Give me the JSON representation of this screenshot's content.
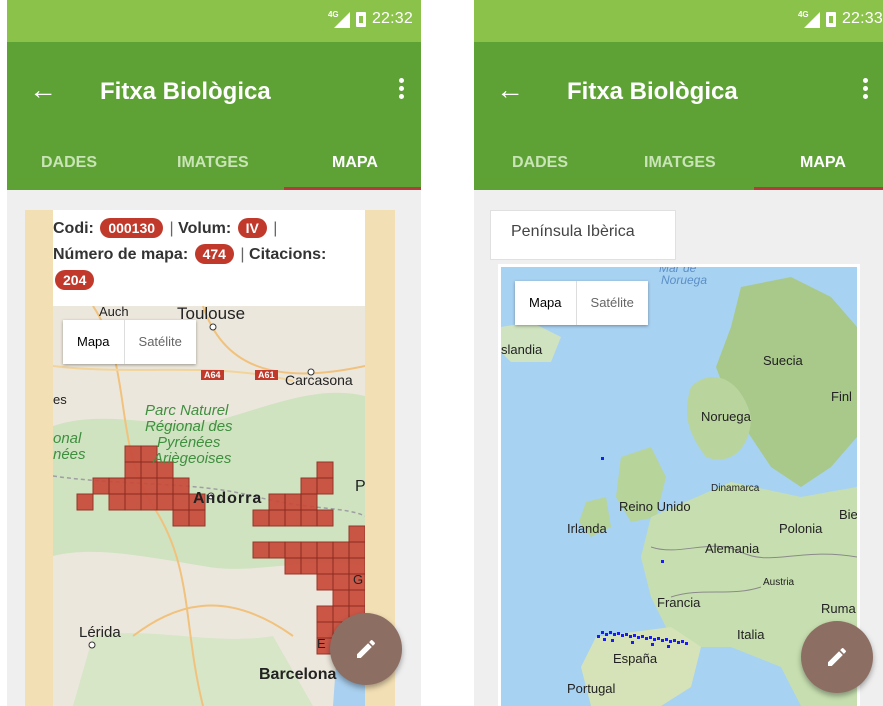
{
  "left": {
    "status": {
      "network": "4G",
      "time": "22:32"
    },
    "appbar": {
      "title": "Fitxa Biològica",
      "back_icon": "arrow-left-icon",
      "menu_icon": "more-vert-icon"
    },
    "tabs": [
      {
        "label": "DADES"
      },
      {
        "label": "IMATGES"
      },
      {
        "label": "MAPA",
        "active": true
      }
    ],
    "info": {
      "codi_label": "Codi:",
      "codi_value": "000130",
      "volum_label": "Volum:",
      "volum_value": "IV",
      "mapa_label": "Número de mapa:",
      "mapa_value": "474",
      "citacions_label": "Citacions:",
      "citacions_value": "204"
    },
    "map": {
      "type_options": [
        "Mapa",
        "Satélite"
      ],
      "selected_type": "Mapa",
      "labels": {
        "auch": "Auch",
        "toulouse": "Toulouse",
        "carcassonne": "Carcasona",
        "park": [
          "Parc Naturel",
          "Régional des",
          "Pyrénées",
          "Ariègeoises"
        ],
        "andorra": "Andorra",
        "lerida": "Lérida",
        "barcelona": "Barcelona",
        "onal": "onal",
        "nees": "nées",
        "es": "es",
        "p": "P",
        "g": "G",
        "e": "E"
      },
      "roads": [
        "A64",
        "A61"
      ]
    },
    "fab_icon": "edit-pencil-icon"
  },
  "right": {
    "status": {
      "network": "4G",
      "time": "22:33"
    },
    "appbar": {
      "title": "Fitxa Biològica",
      "back_icon": "arrow-left-icon",
      "menu_icon": "more-vert-icon"
    },
    "tabs": [
      {
        "label": "DADES"
      },
      {
        "label": "IMATGES"
      },
      {
        "label": "MAPA",
        "active": true
      }
    ],
    "region_tab": "Península Ibèrica",
    "map": {
      "type_options": [
        "Mapa",
        "Satélite"
      ],
      "selected_type": "Mapa",
      "labels": {
        "mar_noruega": "Mar de",
        "noruega_sea": "Noruega",
        "islandia": "slandia",
        "suecia": "Suecia",
        "finl": "Finl",
        "noruega": "Noruega",
        "dinamarca": "Dinamarca",
        "reino_unido": "Reino Unido",
        "irlanda": "Irlanda",
        "bie": "Bie",
        "polonia": "Polonia",
        "alemania": "Alemania",
        "austria": "Austria",
        "francia": "Francia",
        "ruma": "Ruma",
        "italia": "Italia",
        "espana": "España",
        "portugal": "Portugal"
      }
    },
    "fab_icon": "edit-pencil-icon"
  },
  "colors": {
    "appbar": "#5ea236",
    "statusbar": "#8bc34a",
    "badge": "#c0392b",
    "fab": "#8d6e63",
    "tab_indicator": "#b23b3b"
  }
}
